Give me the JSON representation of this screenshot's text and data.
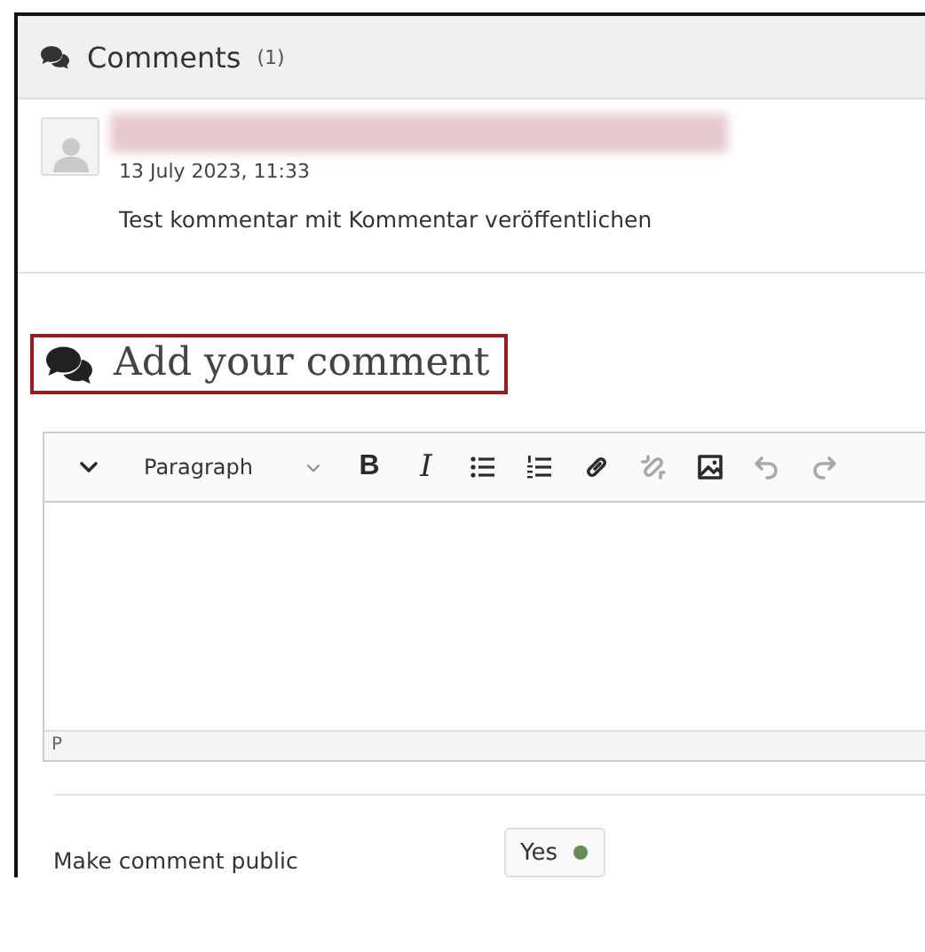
{
  "comments_panel": {
    "title": "Comments",
    "count": "(1)",
    "comments": [
      {
        "author_redacted": true,
        "date": "13 July 2023, 11:33",
        "text": "Test kommentar mit Kommentar veröffentlichen"
      }
    ]
  },
  "add_comment": {
    "heading": "Add your comment",
    "highlighted": true,
    "toolbar": [
      {
        "kind": "collapse",
        "disabled": false
      },
      {
        "kind": "dropdown",
        "label": "Paragraph",
        "disabled": false
      },
      {
        "kind": "bold",
        "label": "B",
        "disabled": false
      },
      {
        "kind": "italic",
        "label": "I",
        "disabled": false
      },
      {
        "kind": "bullet-list",
        "disabled": false
      },
      {
        "kind": "numbered-list",
        "disabled": false
      },
      {
        "kind": "link",
        "disabled": false
      },
      {
        "kind": "unlink",
        "disabled": true
      },
      {
        "kind": "image",
        "disabled": false
      },
      {
        "kind": "undo",
        "disabled": true
      },
      {
        "kind": "redo",
        "disabled": true
      }
    ],
    "status_path": "P"
  },
  "public_setting": {
    "label": "Make comment public",
    "toggle": {
      "label": "Yes",
      "on": true
    }
  }
}
